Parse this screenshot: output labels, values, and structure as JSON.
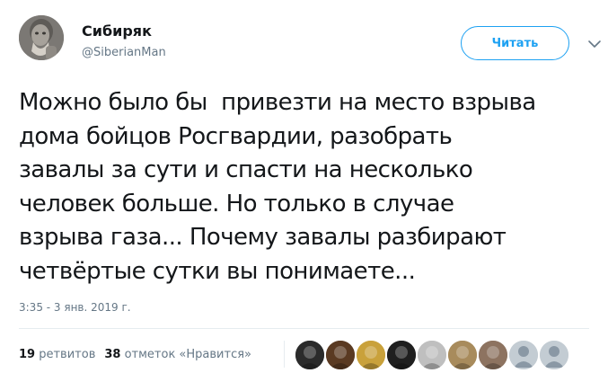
{
  "tweet": {
    "author": {
      "display_name": "Сибиряк",
      "handle": "@SiberianMan"
    },
    "follow_label": "Читать",
    "text": "Можно было бы  привезти на место взрыва\nдома бойцов Росгвардии, разобрать\nзавалы за сути и спасти на несколько\nчеловек больше. Но только в случае\nвзрыва газа... Почему завалы разбирают\nчетвёртые сутки вы понимаете...",
    "timestamp": "3:35 - 3 янв. 2019 г.",
    "stats": {
      "retweets_count": "19",
      "retweets_label": "ретвитов",
      "likes_count": "38",
      "likes_label": "отметок «Нравится»"
    },
    "likers": [
      {
        "icon": "liker-avatar-1",
        "color": "#2b2b2b"
      },
      {
        "icon": "liker-avatar-2",
        "color": "#5a3a22"
      },
      {
        "icon": "liker-avatar-3",
        "color": "#c9a13b"
      },
      {
        "icon": "liker-avatar-4",
        "color": "#1f1f1f"
      },
      {
        "icon": "liker-avatar-5",
        "color": "#bfbfbf"
      },
      {
        "icon": "liker-avatar-6",
        "color": "#a88b5c"
      },
      {
        "icon": "liker-avatar-7",
        "color": "#8d7360"
      },
      {
        "icon": "liker-avatar-8",
        "color": "#c3ccd3"
      },
      {
        "icon": "liker-avatar-9",
        "color": "#c3ccd3"
      }
    ]
  },
  "colors": {
    "accent": "#1da1f2",
    "text_primary": "#14171a",
    "text_secondary": "#657786",
    "divider": "#e6ecf0"
  }
}
